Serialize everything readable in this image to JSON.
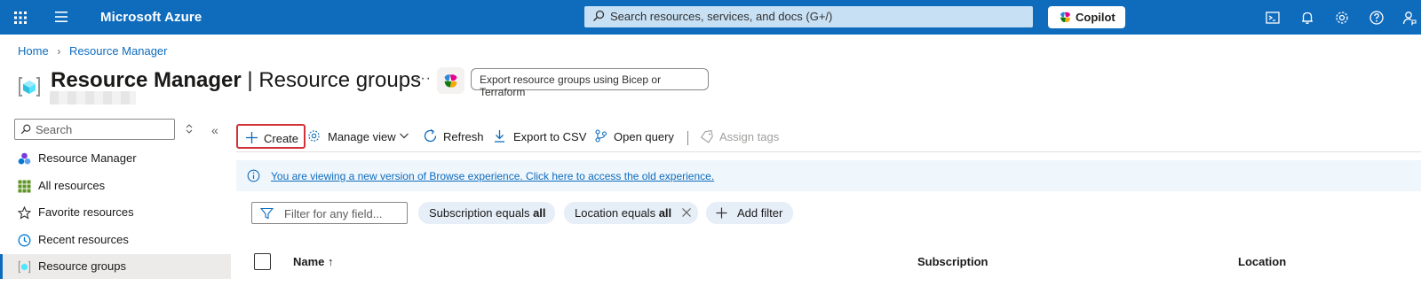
{
  "topbar": {
    "brand": "Microsoft Azure",
    "search_placeholder": "Search resources, services, and docs (G+/)",
    "copilot_label": "Copilot",
    "icons": [
      "cloud-shell-icon",
      "notifications-bell-icon",
      "settings-gear-icon",
      "help-question-icon",
      "feedback-person-icon"
    ]
  },
  "breadcrumb": {
    "home": "Home",
    "current": "Resource Manager"
  },
  "page": {
    "title_bold": "Resource Manager",
    "title_sep": " | ",
    "title_rest": "Resource groups",
    "more": "···",
    "export_chip": "Export resource groups using Bicep or Terraform"
  },
  "sidebar": {
    "search_placeholder": "Search",
    "collapse": "«",
    "items": [
      {
        "label": "Resource Manager",
        "icon": "resource-manager-icon",
        "active": false
      },
      {
        "label": "All resources",
        "icon": "grid-icon",
        "active": false
      },
      {
        "label": "Favorite resources",
        "icon": "star-icon",
        "active": false
      },
      {
        "label": "Recent resources",
        "icon": "clock-icon",
        "active": false
      },
      {
        "label": "Resource groups",
        "icon": "resource-group-icon",
        "active": true
      }
    ]
  },
  "commands": {
    "create": "Create",
    "manage_view": "Manage view",
    "refresh": "Refresh",
    "export_csv": "Export to CSV",
    "open_query": "Open query",
    "assign_tags": "Assign tags"
  },
  "banner": {
    "text": "You are viewing a new version of Browse experience. Click here to access the old experience."
  },
  "filters": {
    "placeholder": "Filter for any field...",
    "subscription_prefix": "Subscription equals ",
    "subscription_value": "all",
    "location_prefix": "Location equals ",
    "location_value": "all",
    "add_filter": "Add filter"
  },
  "grid": {
    "columns": {
      "name": "Name ↑",
      "subscription": "Subscription",
      "location": "Location"
    }
  },
  "colors": {
    "topbar": "#0f6cbd",
    "accent": "#0f6cbd",
    "highlight_border": "#d13438"
  }
}
